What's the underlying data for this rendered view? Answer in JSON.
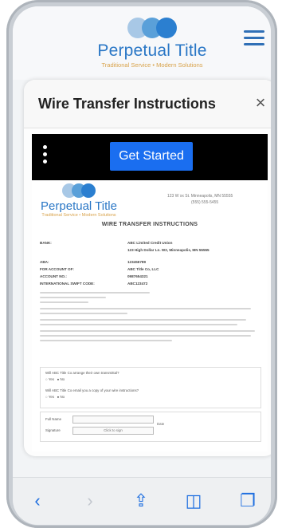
{
  "header": {
    "brand": "Perpetual Title",
    "tagline": "Traditional Service • Modern Solutions"
  },
  "modal": {
    "title": "Wire Transfer Instructions",
    "close_glyph": "×",
    "cta_label": "Get Started"
  },
  "document": {
    "brand": "Perpetual Title",
    "tagline": "Traditional Service • Modern Solutions",
    "address_line1": "123 W xx St. Minneapolis, MN 55555",
    "address_line2": "(555) 555-5455",
    "heading": "WIRE TRANSFER INSTRUCTIONS",
    "rows": [
      {
        "key": "BANK:",
        "value": "ABC Limited Credit Union"
      },
      {
        "key": "",
        "value": "123 High Dollar Ln. W2, Minneapolis, MN 55555"
      },
      {
        "key": "ABA:",
        "value": "123456789"
      },
      {
        "key": "FOR ACCOUNT OF:",
        "value": "ABC Title Co, LLC"
      },
      {
        "key": "ACCOUNT NO.:",
        "value": "0987654321"
      },
      {
        "key": "INTERNATIONAL SWIFT CODE:",
        "value": "ABC123472"
      }
    ],
    "q1": "Will ABC Title Co arrange their own transmittal?",
    "q2": "Will ABC Title Co email you a copy of your wire instructions?",
    "yes": "Yes",
    "no": "No",
    "signature_label": "Signature",
    "signature_field": "Click to sign",
    "name_label": "Full Name",
    "date_label": "Date"
  },
  "toolbar": {
    "back": "‹",
    "forward": "›",
    "share": "⇪",
    "bookmarks": "◫",
    "tabs": "❐"
  },
  "colors": {
    "brand_blue": "#2a77c6",
    "cta_blue": "#1a6ef0",
    "tagline_gold": "#d8a24a"
  }
}
